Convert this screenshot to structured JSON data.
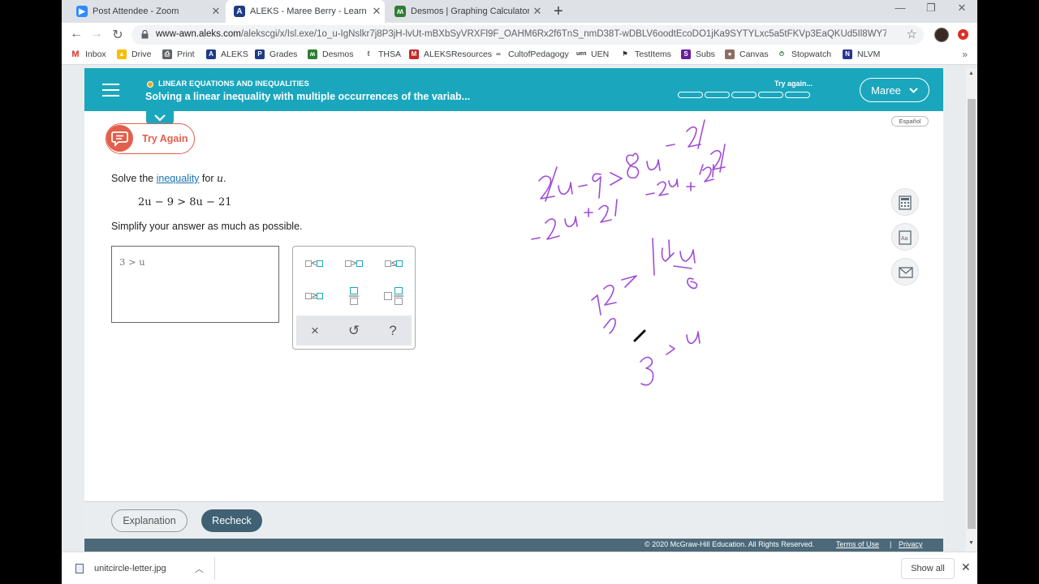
{
  "tabs": [
    {
      "title": "Post Attendee - Zoom",
      "icon": "zoom-icon",
      "color": "#2d8cff"
    },
    {
      "title": "ALEKS - Maree Berry - Learn",
      "icon": "aleks-icon",
      "color": "#1f3c88"
    },
    {
      "title": "Desmos | Graphing Calculator",
      "icon": "desmos-icon",
      "color": "#2e7d32"
    }
  ],
  "address": {
    "host": "www-awn.aleks.com",
    "path": "/alekscgi/x/Isl.exe/1o_u-IgNslkr7j8P3jH-lvUt-mBXbSyVRXFl9F_OAHM6Rx2f6TnS_nmD38T-wDBLV6oodtEcoDO1jKa9SYTYLxc5a5tFKVp3EaQKUd5Il8WY7xlXB?1o..."
  },
  "bookmarks": [
    "Inbox",
    "Drive",
    "Print",
    "ALEKS",
    "Grades",
    "Desmos",
    "THSA",
    "ALEKSResources",
    "CultofPedagogy",
    "UEN",
    "TestItems",
    "Subs",
    "Canvas",
    "Stopwatch",
    "NLVM"
  ],
  "bookmark_more": "»",
  "aleks": {
    "topic": "LINEAR EQUATIONS AND INEQUALITIES",
    "lesson": "Solving a linear inequality with multiple occurrences of the variab...",
    "status": "Try again...",
    "progress_segments": 5,
    "user": "Maree",
    "espanol": "Español",
    "try_again": "Try Again",
    "question": {
      "pre": "Solve the",
      "link": "inequality",
      "mid": "for",
      "var": "u",
      "end": "."
    },
    "equation": "2u − 9 > 8u − 21",
    "instruction": "Simplify your answer as much as possible.",
    "answer": "3 > u",
    "keypad": {
      "keys": [
        "less-than",
        "greater-than",
        "less-or-equal",
        "greater-or-equal",
        "fraction",
        "mixed-number"
      ],
      "clear": "×",
      "undo": "↺",
      "help": "?"
    },
    "side_tools": [
      "calculator-icon",
      "dictionary-icon",
      "mail-icon"
    ],
    "explanation": "Explanation",
    "recheck": "Recheck",
    "copyright": "© 2020 McGraw-Hill Education. All Rights Reserved.",
    "terms": "Terms of Use",
    "privacy": "Privacy",
    "pipe": "|"
  },
  "downloads": {
    "file": "unitcircle-letter.jpg",
    "show_all": "Show all"
  },
  "colors": {
    "aleks_header": "#1aa7be",
    "ink": "#a04bd6",
    "try_again": "#e35f4b",
    "recheck": "#3f6173"
  }
}
